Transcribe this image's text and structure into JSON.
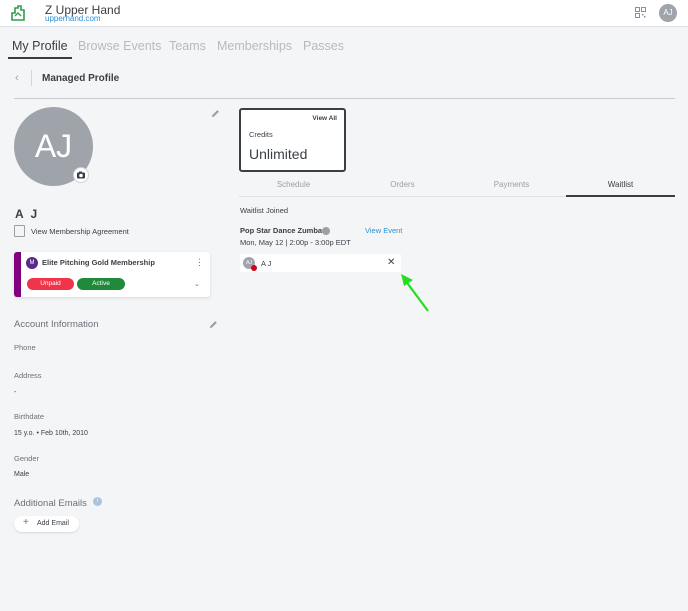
{
  "header": {
    "brand_name": "Z Upper Hand",
    "brand_url": "upperhand.com",
    "user_initials": "AJ"
  },
  "nav": {
    "tabs": [
      {
        "label": "My Profile",
        "active": true
      },
      {
        "label": "Browse Events",
        "active": false
      },
      {
        "label": "Teams",
        "active": false
      },
      {
        "label": "Memberships",
        "active": false
      },
      {
        "label": "Passes",
        "active": false
      }
    ]
  },
  "page": {
    "back_icon": "chevron-left-icon",
    "title": "Managed Profile"
  },
  "profile": {
    "initials": "AJ",
    "name": "A J",
    "agreement_link": "View Membership Agreement"
  },
  "membership": {
    "title": "Elite Pitching Gold Membership",
    "badge_initial": "M",
    "status_unpaid": "Unpaid",
    "status_active": "Active",
    "colors": {
      "bar": "#800080",
      "unpaid": "#f0344a",
      "active": "#1f8a3a"
    }
  },
  "account": {
    "heading": "Account Information",
    "phone_label": "Phone",
    "address_label": "Address",
    "address_value": "-",
    "birthdate_label": "Birthdate",
    "birthdate_value": "15 y.o. • Feb 10th, 2010",
    "gender_label": "Gender",
    "gender_value": "Male"
  },
  "emails": {
    "heading": "Additional Emails",
    "add_label": "Add Email"
  },
  "credits": {
    "view_all": "View All",
    "label": "Credits",
    "value": "Unlimited"
  },
  "profile_tabs": [
    {
      "label": "Schedule",
      "active": false
    },
    {
      "label": "Orders",
      "active": false
    },
    {
      "label": "Payments",
      "active": false
    },
    {
      "label": "Waitlist",
      "active": true
    }
  ],
  "waitlist": {
    "heading": "Waitlist Joined",
    "event_name": "Pop Star Dance Zumba",
    "view_event": "View Event",
    "event_time": "Mon, May 12 | 2:00p - 3:00p EDT",
    "attendee_initials": "AJ",
    "attendee_name": "A J"
  },
  "annotation": {
    "arrow_color": "#22dd22"
  }
}
